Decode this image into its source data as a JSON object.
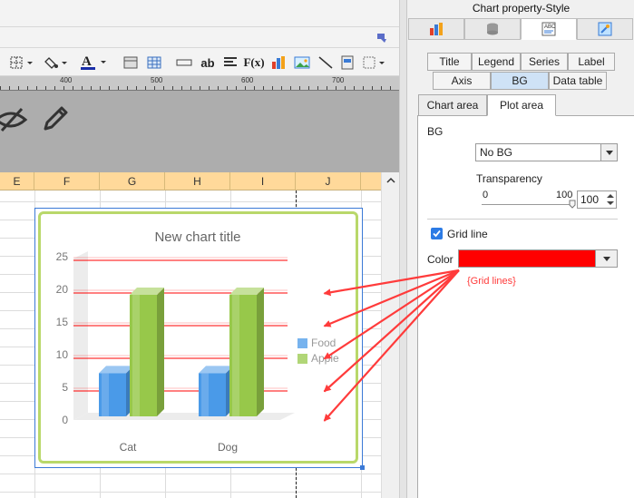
{
  "spreadsheet": {
    "ruler_labels": [
      "400",
      "500",
      "600",
      "700"
    ],
    "columns": [
      "E",
      "F",
      "G",
      "H",
      "I",
      "J"
    ]
  },
  "chart": {
    "title": "New chart title",
    "legend": [
      "Food",
      "Apple"
    ]
  },
  "chart_data": {
    "type": "bar",
    "title": "New chart title",
    "categories": [
      "Cat",
      "Dog"
    ],
    "series": [
      {
        "name": "Food",
        "values": [
          8,
          8
        ],
        "color": "#4a9ae8"
      },
      {
        "name": "Apple",
        "values": [
          20,
          20
        ],
        "color": "#97c84a"
      }
    ],
    "ylim": [
      0,
      25
    ],
    "yticks": [
      "0",
      "5",
      "10",
      "15",
      "20",
      "25"
    ],
    "grid": true,
    "grid_color": "#ff0000",
    "legend_position": "right"
  },
  "panel": {
    "title": "Chart property-Style",
    "top_tabs": [
      "chart-type-icon",
      "database-icon",
      "text-style-icon",
      "effects-icon"
    ],
    "sub_tabs_row1": [
      "Title",
      "Legend",
      "Series",
      "Label"
    ],
    "sub_tabs_row2": [
      "Axis",
      "BG",
      "Data table"
    ],
    "area_tabs": [
      "Chart area",
      "Plot area"
    ],
    "bg_label": "BG",
    "bg_value": "No BG",
    "transparency_label": "Transparency",
    "slider_min": "0",
    "slider_max": "100",
    "transparency_value": "100",
    "grid_line_label": "Grid line",
    "grid_line_checked": true,
    "color_label": "Color",
    "color_value": "#ff0000",
    "annotation": "{Grid lines}"
  },
  "colors": {
    "accent": "#3b79d6",
    "annotation": "#ff3b3b",
    "column_header": "#ffd99a"
  }
}
